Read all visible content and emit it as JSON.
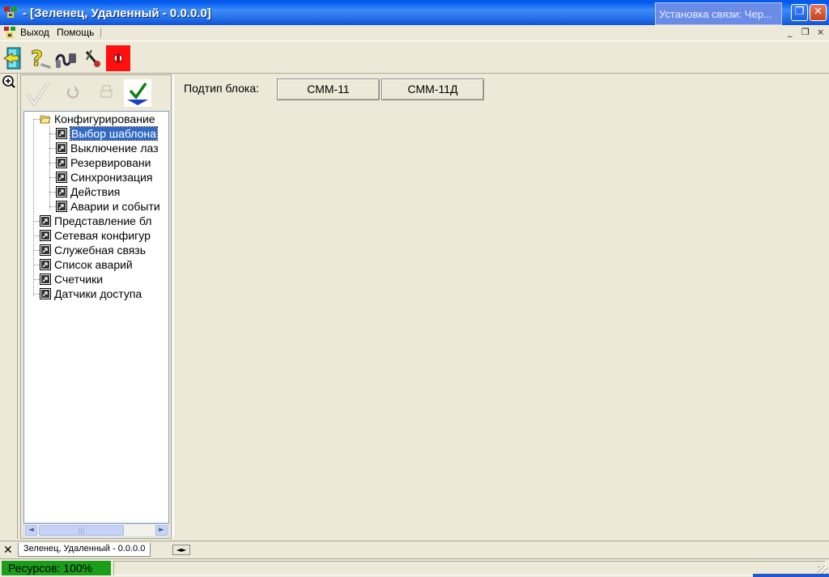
{
  "window": {
    "title": "- [Зеленец, Удаленный - 0.0.0.0]",
    "notification": "Установка связи: Чер...",
    "minimize_glyph": "_",
    "restore_glyph": "❐",
    "close_glyph": "✕"
  },
  "menu": {
    "items": [
      {
        "label": "Выход"
      },
      {
        "label": "Помощь"
      }
    ],
    "mdi_controls": [
      "_",
      "❐",
      "×"
    ]
  },
  "toolbar": {
    "buttons": [
      "exit-door-icon",
      "help-icon",
      "connection-icon",
      "settings-icon",
      "alarm-icon"
    ]
  },
  "tree_toolbar": {
    "buttons": [
      "apply-check-icon",
      "refresh-icon",
      "print-icon",
      "confirm-check-icon"
    ]
  },
  "tree": {
    "nodes": [
      {
        "label": "Конфигурирование",
        "level": 0,
        "icon": "folder-open-icon"
      },
      {
        "label": "Выбор шаблона",
        "level": 1,
        "icon": "shortcut-icon",
        "selected": true
      },
      {
        "label": "Выключение лаз",
        "level": 1,
        "icon": "shortcut-icon"
      },
      {
        "label": "Резервировани",
        "level": 1,
        "icon": "shortcut-icon"
      },
      {
        "label": "Синхронизация",
        "level": 1,
        "icon": "shortcut-icon"
      },
      {
        "label": "Действия",
        "level": 1,
        "icon": "shortcut-icon"
      },
      {
        "label": "Аварии и событи",
        "level": 1,
        "icon": "shortcut-icon"
      },
      {
        "label": "Представление бл",
        "level": 0,
        "icon": "shortcut-icon"
      },
      {
        "label": "Сетевая конфигур",
        "level": 0,
        "icon": "shortcut-icon"
      },
      {
        "label": "Служебная связь",
        "level": 0,
        "icon": "shortcut-icon"
      },
      {
        "label": "Список аварий",
        "level": 0,
        "icon": "shortcut-icon"
      },
      {
        "label": "Счетчики",
        "level": 0,
        "icon": "shortcut-icon"
      },
      {
        "label": "Датчики доступа",
        "level": 0,
        "icon": "shortcut-icon"
      }
    ]
  },
  "main": {
    "subtype_label": "Подтип блока:",
    "subtype_buttons": [
      {
        "label": "СММ-11"
      },
      {
        "label": "СММ-11Д"
      }
    ]
  },
  "tabs": {
    "close_glyph": "✕",
    "active_tab": "Зеленец, Удаленный - 0.0.0.0",
    "nav_glyph": "◄►"
  },
  "status": {
    "resources": "Ресурсов: 100%"
  },
  "scrollbar": {
    "left_arrow": "◄",
    "right_arrow": "►",
    "thumb_grip": "|||"
  }
}
